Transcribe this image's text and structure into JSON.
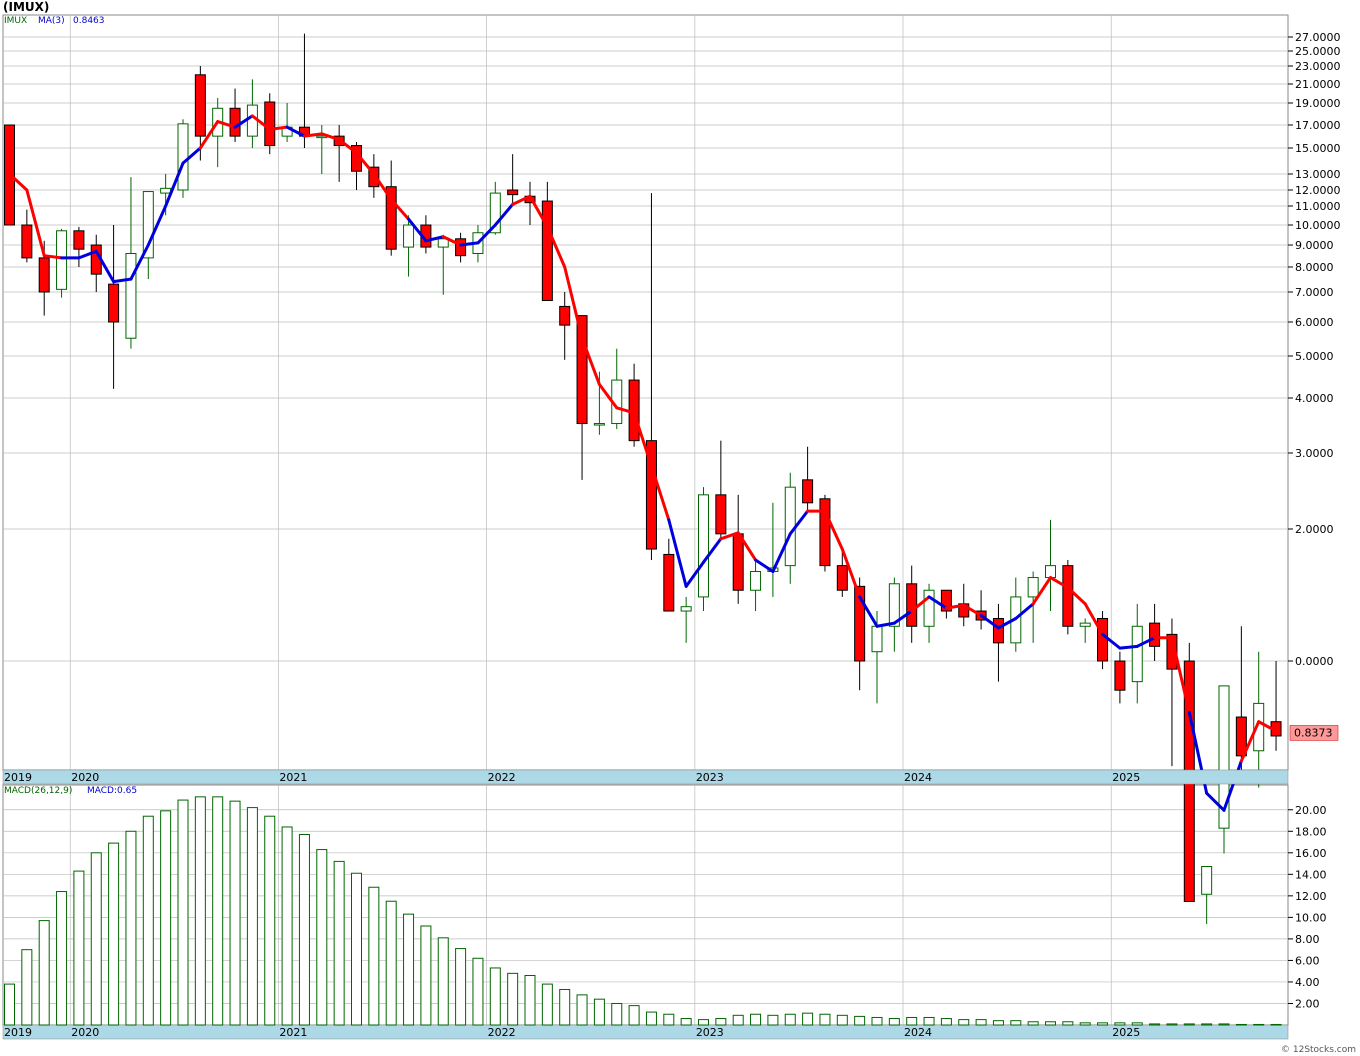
{
  "title": "(IMUX)",
  "legend": {
    "ticker": "IMUX",
    "ma_label": "MA(3)",
    "ma_value": "0.8463",
    "macd_label": "MACD(26,12,9)",
    "macd_value": "MACD:0.65"
  },
  "last_price_label": "0.8373",
  "footer": "© 12Stocks.com",
  "colors": {
    "down_fill": "#ff0000",
    "up_fill": "#ffffff",
    "up_stroke": "#006600",
    "ma_up": "#0000dd",
    "ma_down": "#ff0000",
    "axis_band": "#add8e6",
    "grid": "#bbbbbb",
    "price_box": "#ff9999"
  },
  "chart_data": [
    {
      "type": "candlestick",
      "title": "(IMUX)",
      "scale": "log-like (irregular below 1)",
      "y_ticks": [
        27,
        25,
        23,
        21,
        19,
        17,
        15,
        13,
        12,
        11,
        10,
        9,
        8,
        7,
        6,
        5,
        4,
        3,
        2,
        1
      ],
      "y_tick_labels": [
        "27.0000",
        "25.0000",
        "23.0000",
        "21.0000",
        "19.0000",
        "17.0000",
        "15.0000",
        "13.0000",
        "12.0000",
        "11.0000",
        "10.0000",
        "9.0000",
        "8.0000",
        "7.0000",
        "6.0000",
        "5.0000",
        "4.0000",
        "3.0000",
        "2.0000",
        "0.0000"
      ],
      "x_labels": [
        "2019",
        "2020",
        "2021",
        "2022",
        "2023",
        "2024",
        "2025"
      ],
      "x_label_months": [
        0,
        4,
        16,
        28,
        40,
        52,
        64
      ],
      "ma_period": 3,
      "grid": true,
      "candles": [
        {
          "m": 0,
          "o": 17.0,
          "h": 17.0,
          "l": 10.0,
          "c": 10.0
        },
        {
          "m": 1,
          "o": 10.0,
          "h": 10.8,
          "l": 8.2,
          "c": 8.4
        },
        {
          "m": 2,
          "o": 8.4,
          "h": 9.2,
          "l": 6.2,
          "c": 7.0
        },
        {
          "m": 3,
          "o": 7.1,
          "h": 9.8,
          "l": 6.8,
          "c": 9.7
        },
        {
          "m": 4,
          "o": 9.7,
          "h": 9.9,
          "l": 8.0,
          "c": 8.8
        },
        {
          "m": 5,
          "o": 9.0,
          "h": 9.5,
          "l": 7.0,
          "c": 7.7
        },
        {
          "m": 6,
          "o": 7.3,
          "h": 10.0,
          "l": 4.2,
          "c": 6.0
        },
        {
          "m": 7,
          "o": 5.5,
          "h": 12.8,
          "l": 5.2,
          "c": 8.6
        },
        {
          "m": 8,
          "o": 8.4,
          "h": 11.8,
          "l": 7.5,
          "c": 11.9
        },
        {
          "m": 9,
          "o": 11.8,
          "h": 13.0,
          "l": 10.5,
          "c": 12.1
        },
        {
          "m": 10,
          "o": 12.0,
          "h": 17.5,
          "l": 11.5,
          "c": 17.1
        },
        {
          "m": 11,
          "o": 22.0,
          "h": 23.0,
          "l": 14.0,
          "c": 16.0
        },
        {
          "m": 12,
          "o": 16.0,
          "h": 19.5,
          "l": 13.5,
          "c": 18.5
        },
        {
          "m": 13,
          "o": 18.5,
          "h": 20.5,
          "l": 15.5,
          "c": 16.0
        },
        {
          "m": 14,
          "o": 16.0,
          "h": 21.5,
          "l": 15.0,
          "c": 18.8
        },
        {
          "m": 15,
          "o": 19.1,
          "h": 20.0,
          "l": 14.5,
          "c": 15.2
        },
        {
          "m": 16,
          "o": 16.0,
          "h": 19.0,
          "l": 15.5,
          "c": 16.8
        },
        {
          "m": 17,
          "o": 16.8,
          "h": 27.5,
          "l": 15.0,
          "c": 16.0
        },
        {
          "m": 18,
          "o": 16.0,
          "h": 17.0,
          "l": 13.0,
          "c": 16.0
        },
        {
          "m": 19,
          "o": 16.0,
          "h": 17.0,
          "l": 12.5,
          "c": 15.2
        },
        {
          "m": 20,
          "o": 15.2,
          "h": 15.5,
          "l": 12.0,
          "c": 13.2
        },
        {
          "m": 21,
          "o": 13.5,
          "h": 14.5,
          "l": 11.5,
          "c": 12.2
        },
        {
          "m": 22,
          "o": 12.2,
          "h": 14.0,
          "l": 8.5,
          "c": 8.8
        },
        {
          "m": 23,
          "o": 8.9,
          "h": 10.5,
          "l": 7.6,
          "c": 10.0
        },
        {
          "m": 24,
          "o": 10.0,
          "h": 10.5,
          "l": 8.6,
          "c": 8.9
        },
        {
          "m": 25,
          "o": 8.9,
          "h": 9.5,
          "l": 6.9,
          "c": 9.3
        },
        {
          "m": 26,
          "o": 9.3,
          "h": 9.6,
          "l": 8.2,
          "c": 8.5
        },
        {
          "m": 27,
          "o": 8.6,
          "h": 10.0,
          "l": 8.2,
          "c": 9.6
        },
        {
          "m": 28,
          "o": 9.6,
          "h": 12.5,
          "l": 9.5,
          "c": 11.8
        },
        {
          "m": 29,
          "o": 12.0,
          "h": 14.5,
          "l": 11.0,
          "c": 11.7
        },
        {
          "m": 30,
          "o": 11.6,
          "h": 12.5,
          "l": 10.0,
          "c": 11.2
        },
        {
          "m": 31,
          "o": 11.3,
          "h": 12.5,
          "l": 6.7,
          "c": 6.7
        },
        {
          "m": 32,
          "o": 6.5,
          "h": 7.0,
          "l": 4.9,
          "c": 5.9
        },
        {
          "m": 33,
          "o": 6.2,
          "h": 6.2,
          "l": 2.6,
          "c": 3.5
        },
        {
          "m": 34,
          "o": 3.5,
          "h": 4.6,
          "l": 3.3,
          "c": 3.5
        },
        {
          "m": 35,
          "o": 3.5,
          "h": 5.2,
          "l": 3.4,
          "c": 4.4
        },
        {
          "m": 36,
          "o": 4.4,
          "h": 4.8,
          "l": 3.1,
          "c": 3.2
        },
        {
          "m": 37,
          "o": 3.2,
          "h": 11.8,
          "l": 1.7,
          "c": 1.8
        },
        {
          "m": 38,
          "o": 1.75,
          "h": 1.9,
          "l": 1.3,
          "c": 1.3
        },
        {
          "m": 39,
          "o": 1.3,
          "h": 1.4,
          "l": 1.1,
          "c": 1.33
        },
        {
          "m": 40,
          "o": 1.4,
          "h": 2.5,
          "l": 1.3,
          "c": 2.4
        },
        {
          "m": 41,
          "o": 2.4,
          "h": 3.2,
          "l": 1.9,
          "c": 1.95
        },
        {
          "m": 42,
          "o": 1.95,
          "h": 2.4,
          "l": 1.35,
          "c": 1.45
        },
        {
          "m": 43,
          "o": 1.45,
          "h": 1.7,
          "l": 1.3,
          "c": 1.6
        },
        {
          "m": 44,
          "o": 1.6,
          "h": 2.3,
          "l": 1.4,
          "c": 1.63
        },
        {
          "m": 45,
          "o": 1.65,
          "h": 2.7,
          "l": 1.5,
          "c": 2.5
        },
        {
          "m": 46,
          "o": 2.6,
          "h": 3.1,
          "l": 2.2,
          "c": 2.3
        },
        {
          "m": 47,
          "o": 2.35,
          "h": 2.4,
          "l": 1.6,
          "c": 1.65
        },
        {
          "m": 48,
          "o": 1.65,
          "h": 1.8,
          "l": 1.4,
          "c": 1.45
        },
        {
          "m": 49,
          "o": 1.48,
          "h": 1.55,
          "l": 0.93,
          "c": 1.0
        },
        {
          "m": 50,
          "o": 1.05,
          "h": 1.3,
          "l": 0.9,
          "c": 1.2
        },
        {
          "m": 51,
          "o": 1.2,
          "h": 1.55,
          "l": 1.05,
          "c": 1.5
        },
        {
          "m": 52,
          "o": 1.5,
          "h": 1.65,
          "l": 1.1,
          "c": 1.2
        },
        {
          "m": 53,
          "o": 1.2,
          "h": 1.5,
          "l": 1.1,
          "c": 1.45
        },
        {
          "m": 54,
          "o": 1.45,
          "h": 1.45,
          "l": 1.25,
          "c": 1.3
        },
        {
          "m": 55,
          "o": 1.35,
          "h": 1.5,
          "l": 1.2,
          "c": 1.26
        },
        {
          "m": 56,
          "o": 1.3,
          "h": 1.45,
          "l": 1.18,
          "c": 1.24
        },
        {
          "m": 57,
          "o": 1.25,
          "h": 1.35,
          "l": 0.95,
          "c": 1.1
        },
        {
          "m": 58,
          "o": 1.1,
          "h": 1.55,
          "l": 1.05,
          "c": 1.4
        },
        {
          "m": 59,
          "o": 1.4,
          "h": 1.6,
          "l": 1.1,
          "c": 1.55
        },
        {
          "m": 60,
          "o": 1.55,
          "h": 2.1,
          "l": 1.3,
          "c": 1.65
        },
        {
          "m": 61,
          "o": 1.65,
          "h": 1.7,
          "l": 1.15,
          "c": 1.2
        },
        {
          "m": 62,
          "o": 1.2,
          "h": 1.25,
          "l": 1.1,
          "c": 1.22
        },
        {
          "m": 63,
          "o": 1.25,
          "h": 1.3,
          "l": 0.98,
          "c": 1.0
        },
        {
          "m": 64,
          "o": 1.0,
          "h": 1.05,
          "l": 0.9,
          "c": 0.93
        },
        {
          "m": 65,
          "o": 0.95,
          "h": 1.35,
          "l": 0.9,
          "c": 1.2
        },
        {
          "m": 66,
          "o": 1.22,
          "h": 1.35,
          "l": 1.0,
          "c": 1.08
        },
        {
          "m": 67,
          "o": 1.15,
          "h": 1.25,
          "l": 0.77,
          "c": 0.98
        },
        {
          "m": 68,
          "o": 1.0,
          "h": 1.1,
          "l": 0.55,
          "c": 0.55
        },
        {
          "m": 69,
          "o": 0.56,
          "h": 0.6,
          "l": 0.52,
          "c": 0.6
        },
        {
          "m": 70,
          "o": 0.66,
          "h": 0.8,
          "l": 0.62,
          "c": 0.94
        },
        {
          "m": 71,
          "o": 0.87,
          "h": 1.2,
          "l": 0.75,
          "c": 0.79
        },
        {
          "m": 72,
          "o": 0.8,
          "h": 1.05,
          "l": 0.73,
          "c": 0.9
        },
        {
          "m": 73,
          "o": 0.86,
          "h": 1.0,
          "l": 0.8,
          "c": 0.83
        }
      ],
      "ma": [
        {
          "m": 0,
          "v": 13.0,
          "d": "down"
        },
        {
          "m": 1,
          "v": 12.0,
          "d": "down"
        },
        {
          "m": 2,
          "v": 8.5,
          "d": "down"
        },
        {
          "m": 3,
          "v": 8.4,
          "d": "down"
        },
        {
          "m": 4,
          "v": 8.4,
          "d": "up"
        },
        {
          "m": 5,
          "v": 8.7,
          "d": "up"
        },
        {
          "m": 6,
          "v": 7.4,
          "d": "up"
        },
        {
          "m": 7,
          "v": 7.5,
          "d": "up"
        },
        {
          "m": 8,
          "v": 9.0,
          "d": "up"
        },
        {
          "m": 9,
          "v": 11.0,
          "d": "up"
        },
        {
          "m": 10,
          "v": 13.8,
          "d": "up"
        },
        {
          "m": 11,
          "v": 15.0,
          "d": "up"
        },
        {
          "m": 12,
          "v": 17.3,
          "d": "down"
        },
        {
          "m": 13,
          "v": 16.8,
          "d": "down"
        },
        {
          "m": 14,
          "v": 17.8,
          "d": "up"
        },
        {
          "m": 15,
          "v": 16.6,
          "d": "down"
        },
        {
          "m": 16,
          "v": 16.8,
          "d": "down"
        },
        {
          "m": 17,
          "v": 16.0,
          "d": "up"
        },
        {
          "m": 18,
          "v": 16.2,
          "d": "down"
        },
        {
          "m": 19,
          "v": 15.7,
          "d": "down"
        },
        {
          "m": 20,
          "v": 14.6,
          "d": "down"
        },
        {
          "m": 21,
          "v": 13.0,
          "d": "down"
        },
        {
          "m": 22,
          "v": 11.4,
          "d": "down"
        },
        {
          "m": 23,
          "v": 10.3,
          "d": "down"
        },
        {
          "m": 24,
          "v": 9.2,
          "d": "up"
        },
        {
          "m": 25,
          "v": 9.4,
          "d": "up"
        },
        {
          "m": 26,
          "v": 9.0,
          "d": "down"
        },
        {
          "m": 27,
          "v": 9.1,
          "d": "up"
        },
        {
          "m": 28,
          "v": 10.0,
          "d": "up"
        },
        {
          "m": 29,
          "v": 11.1,
          "d": "up"
        },
        {
          "m": 30,
          "v": 11.6,
          "d": "down"
        },
        {
          "m": 31,
          "v": 9.9,
          "d": "down"
        },
        {
          "m": 32,
          "v": 8.0,
          "d": "down"
        },
        {
          "m": 33,
          "v": 5.5,
          "d": "down"
        },
        {
          "m": 34,
          "v": 4.3,
          "d": "down"
        },
        {
          "m": 35,
          "v": 3.8,
          "d": "down"
        },
        {
          "m": 36,
          "v": 3.7,
          "d": "down"
        },
        {
          "m": 37,
          "v": 2.8,
          "d": "down"
        },
        {
          "m": 38,
          "v": 2.1,
          "d": "down"
        },
        {
          "m": 39,
          "v": 1.48,
          "d": "up"
        },
        {
          "m": 40,
          "v": 1.68,
          "d": "up"
        },
        {
          "m": 41,
          "v": 1.9,
          "d": "up"
        },
        {
          "m": 42,
          "v": 1.96,
          "d": "down"
        },
        {
          "m": 43,
          "v": 1.7,
          "d": "down"
        },
        {
          "m": 44,
          "v": 1.6,
          "d": "up"
        },
        {
          "m": 45,
          "v": 1.95,
          "d": "up"
        },
        {
          "m": 46,
          "v": 2.2,
          "d": "up"
        },
        {
          "m": 47,
          "v": 2.2,
          "d": "down"
        },
        {
          "m": 48,
          "v": 1.8,
          "d": "down"
        },
        {
          "m": 49,
          "v": 1.4,
          "d": "down"
        },
        {
          "m": 50,
          "v": 1.2,
          "d": "up"
        },
        {
          "m": 51,
          "v": 1.22,
          "d": "up"
        },
        {
          "m": 52,
          "v": 1.3,
          "d": "up"
        },
        {
          "m": 53,
          "v": 1.4,
          "d": "down"
        },
        {
          "m": 54,
          "v": 1.32,
          "d": "up"
        },
        {
          "m": 55,
          "v": 1.34,
          "d": "down"
        },
        {
          "m": 56,
          "v": 1.27,
          "d": "down"
        },
        {
          "m": 57,
          "v": 1.19,
          "d": "up"
        },
        {
          "m": 58,
          "v": 1.25,
          "d": "up"
        },
        {
          "m": 59,
          "v": 1.35,
          "d": "up"
        },
        {
          "m": 60,
          "v": 1.55,
          "d": "down"
        },
        {
          "m": 61,
          "v": 1.47,
          "d": "down"
        },
        {
          "m": 62,
          "v": 1.35,
          "d": "down"
        },
        {
          "m": 63,
          "v": 1.15,
          "d": "down"
        },
        {
          "m": 64,
          "v": 1.07,
          "d": "up"
        },
        {
          "m": 65,
          "v": 1.08,
          "d": "up"
        },
        {
          "m": 66,
          "v": 1.13,
          "d": "up"
        },
        {
          "m": 67,
          "v": 1.13,
          "d": "down"
        },
        {
          "m": 68,
          "v": 0.88,
          "d": "down"
        },
        {
          "m": 69,
          "v": 0.72,
          "d": "up"
        },
        {
          "m": 70,
          "v": 0.69,
          "d": "up"
        },
        {
          "m": 71,
          "v": 0.78,
          "d": "up"
        },
        {
          "m": 72,
          "v": 0.86,
          "d": "down"
        },
        {
          "m": 73,
          "v": 0.84,
          "d": "down"
        }
      ]
    },
    {
      "type": "bar",
      "title": "MACD(26,12,9)",
      "y_ticks": [
        2,
        4,
        6,
        8,
        10,
        12,
        14,
        16,
        18,
        20
      ],
      "y_tick_labels": [
        "2.00",
        "4.00",
        "6.00",
        "8.00",
        "10.00",
        "12.00",
        "14.00",
        "16.00",
        "18.00",
        "20.00"
      ],
      "ylim": [
        0,
        22.3
      ],
      "x_labels": [
        "2019",
        "2020",
        "2021",
        "2022",
        "2023",
        "2024",
        "2025"
      ],
      "grid": true,
      "values": [
        3.8,
        7.0,
        9.7,
        12.4,
        14.3,
        16.0,
        16.9,
        18.0,
        19.4,
        19.9,
        20.9,
        21.2,
        21.2,
        20.8,
        20.2,
        19.4,
        18.4,
        17.7,
        16.3,
        15.2,
        14.1,
        12.8,
        11.5,
        10.3,
        9.2,
        8.1,
        7.1,
        6.2,
        5.3,
        4.8,
        4.6,
        3.8,
        3.3,
        2.8,
        2.4,
        2.0,
        1.8,
        1.2,
        1.0,
        0.6,
        0.5,
        0.6,
        0.9,
        1.0,
        0.9,
        1.0,
        1.1,
        1.0,
        0.9,
        0.8,
        0.7,
        0.6,
        0.7,
        0.7,
        0.6,
        0.5,
        0.5,
        0.4,
        0.4,
        0.3,
        0.3,
        0.3,
        0.2,
        0.2,
        0.2,
        0.2,
        0.1,
        0.1,
        0.1,
        0.1,
        0.1,
        0.05,
        0.05,
        0.05
      ]
    }
  ]
}
